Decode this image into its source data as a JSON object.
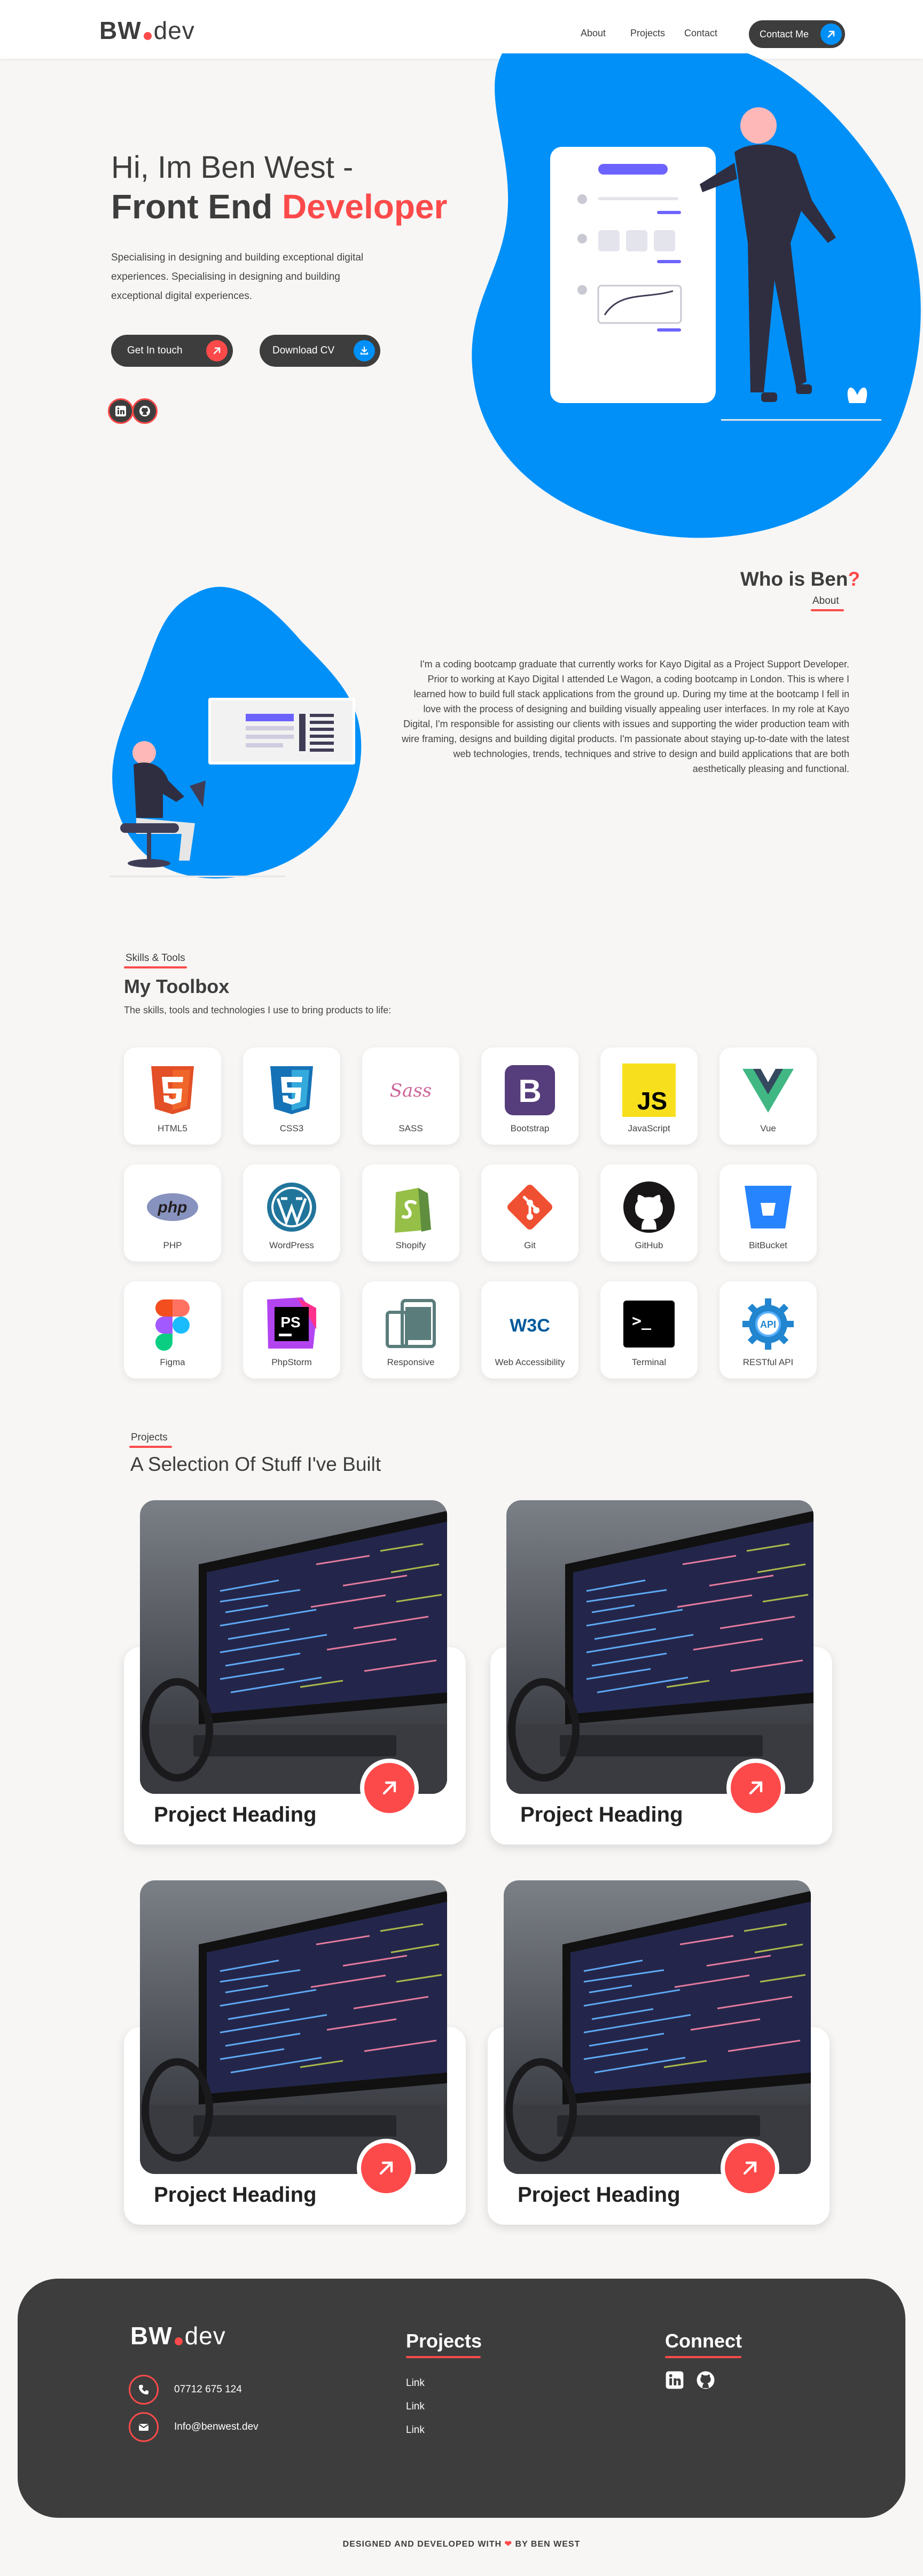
{
  "header": {
    "logo_main": "BW",
    "logo_suffix": "dev",
    "nav": [
      "About",
      "Projects",
      "Contact"
    ],
    "contact_button": "Contact Me"
  },
  "hero": {
    "greeting": "Hi, Im Ben West -",
    "role_prefix": "Front End",
    "role_highlight": "Developer",
    "intro": "Specialising in designing and building exceptional digital experiences. Specialising in designing and building exceptional digital experiences.",
    "get_in_touch": "Get In touch",
    "download_cv": "Download CV"
  },
  "about": {
    "title_prefix": "Who is Ben",
    "title_mark": "?",
    "tag": "About",
    "body": "I'm a coding bootcamp graduate that currently works for Kayo Digital as a Project Support Developer. Prior to working at Kayo Digital I attended Le Wagon, a coding bootcamp in London. This is where I learned how to build full stack applications from the ground up. During my time at the bootcamp I fell in love with the process of designing and building visually appealing user interfaces. In my role at Kayo Digital, I'm responsible for assisting our clients with issues and supporting the wider production team with wire framing, designs and building digital products. I'm passionate about staying up-to-date with the latest web technologies, trends, techniques and strive to design and build applications that are both aesthetically pleasing and functional."
  },
  "skills": {
    "tag": "Skills & Tools",
    "title": "My Toolbox",
    "subtitle": "The skills, tools and technologies I use to bring products to life:",
    "items": [
      {
        "label": "HTML5",
        "icon": "html5-icon"
      },
      {
        "label": "CSS3",
        "icon": "css3-icon"
      },
      {
        "label": "SASS",
        "icon": "sass-icon"
      },
      {
        "label": "Bootstrap",
        "icon": "bootstrap-icon"
      },
      {
        "label": "JavaScript",
        "icon": "javascript-icon"
      },
      {
        "label": "Vue",
        "icon": "vue-icon"
      },
      {
        "label": "PHP",
        "icon": "php-icon"
      },
      {
        "label": "WordPress",
        "icon": "wordpress-icon"
      },
      {
        "label": "Shopify",
        "icon": "shopify-icon"
      },
      {
        "label": "Git",
        "icon": "git-icon"
      },
      {
        "label": "GitHub",
        "icon": "github-icon"
      },
      {
        "label": "BitBucket",
        "icon": "bitbucket-icon"
      },
      {
        "label": "Figma",
        "icon": "figma-icon"
      },
      {
        "label": "PhpStorm",
        "icon": "phpstorm-icon"
      },
      {
        "label": "Responsive",
        "icon": "responsive-icon"
      },
      {
        "label": "Web Accessibility",
        "icon": "w3c-icon"
      },
      {
        "label": "Terminal",
        "icon": "terminal-icon"
      },
      {
        "label": "RESTful API",
        "icon": "api-icon"
      }
    ],
    "icon_text": {
      "js": "JS",
      "php": "php",
      "ps": "PS",
      "w3c": "W3C",
      "api": "API",
      "sass": "Sass",
      "bootstrap": "B",
      "prompt": ">_"
    }
  },
  "projects": {
    "tag": "Projects",
    "title": "A Selection Of Stuff I've Built",
    "items": [
      {
        "heading": "Project Heading"
      },
      {
        "heading": "Project Heading"
      },
      {
        "heading": "Project Heading"
      },
      {
        "heading": "Project Heading"
      }
    ]
  },
  "footer": {
    "phone": "07712 675 124",
    "email": "Info@benwest.dev",
    "projects_title": "Projects",
    "links": [
      "Link",
      "Link",
      "Link"
    ],
    "connect_title": "Connect",
    "credit_prefix": "DESIGNED AND DEVELOPED WITH",
    "credit_suffix": "BY BEN WEST"
  },
  "colors": {
    "accent": "#fc4a4a",
    "blue": "#0090f8",
    "dark": "#3d3d3d",
    "background": "#f7f6f5"
  }
}
